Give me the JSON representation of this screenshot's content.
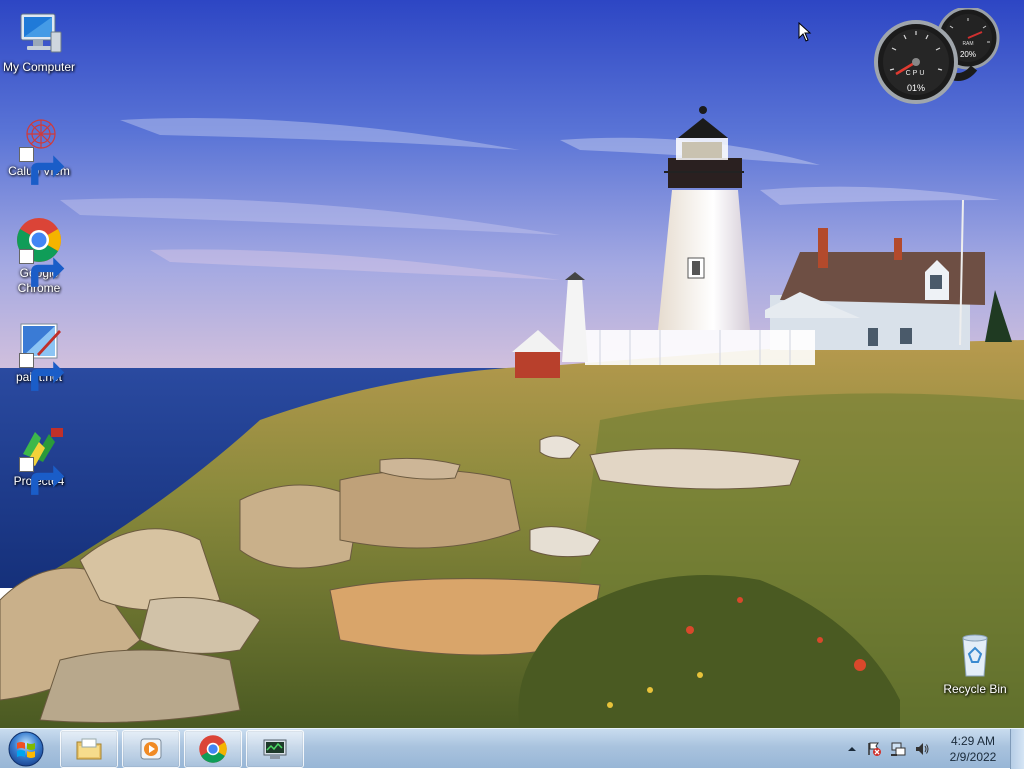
{
  "desktop": {
    "icons": [
      {
        "label": "My Computer",
        "icon": "computer-icon"
      },
      {
        "label": "Calub Viem",
        "icon": "calub-viem-icon"
      },
      {
        "label": "Google Chrome",
        "icon": "chrome-icon"
      },
      {
        "label": "paint.net",
        "icon": "paintnet-icon"
      },
      {
        "label": "Project64",
        "icon": "project64-icon"
      },
      {
        "label": "Recycle Bin",
        "icon": "recycle-bin-icon"
      }
    ]
  },
  "gadget": {
    "cpu_label": "CPU",
    "cpu_value": "01%",
    "ram_label": "RAM",
    "ram_value": "20%"
  },
  "taskbar": {
    "pinned": [
      {
        "name": "windows-explorer",
        "icon": "folder-icon"
      },
      {
        "name": "media-player",
        "icon": "media-player-icon"
      },
      {
        "name": "google-chrome",
        "icon": "chrome-icon"
      },
      {
        "name": "system-monitor",
        "icon": "monitor-icon"
      }
    ],
    "clock": {
      "time": "4:29 AM",
      "date": "2/9/2022"
    }
  },
  "colors": {
    "taskbar": "#a9c3de",
    "sky_top": "#3d55c6",
    "sea": "#1e3f8f",
    "grass": "#7a8a3a"
  }
}
